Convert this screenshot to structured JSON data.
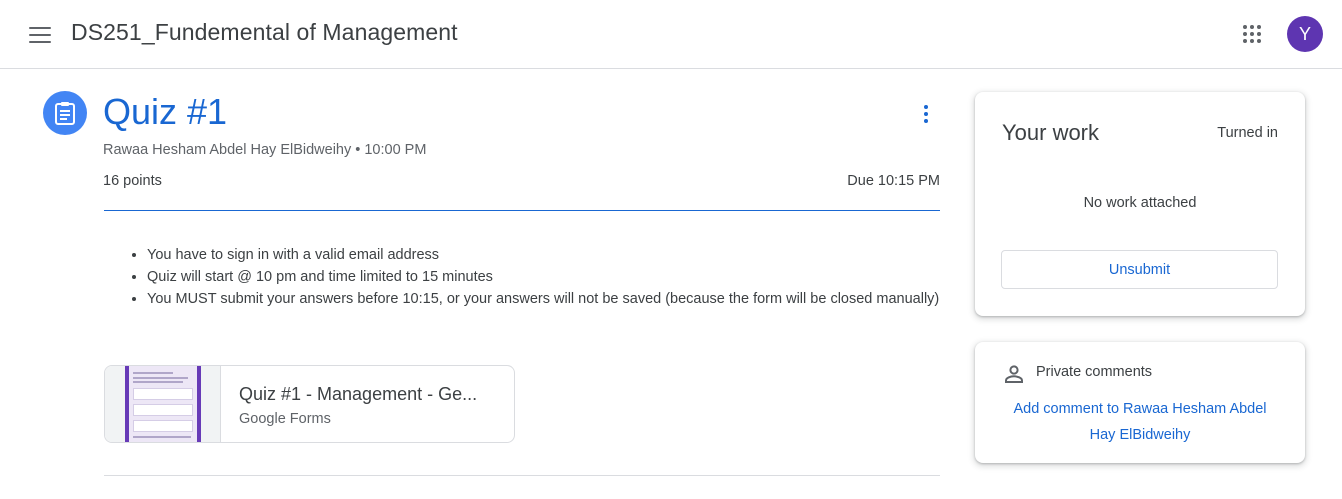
{
  "header": {
    "menu_icon": "hamburger-menu-icon",
    "class_title": "DS251_Fundemental of Management",
    "apps_icon": "google-apps-grid-icon",
    "avatar_letter": "Y",
    "avatar_color": "#5e35b1"
  },
  "assignment": {
    "icon": "assignment-clipboard-icon",
    "title": "Quiz #1",
    "meta": "Rawaa Hesham Abdel Hay ElBidweihy • 10:00 PM",
    "points": "16 points",
    "due": "Due 10:15 PM",
    "more_icon": "more-vert-icon",
    "instructions": [
      "You have to sign in with a valid email address",
      "Quiz will start @ 10 pm and time limited to 15 minutes",
      "You MUST submit your answers before 10:15, or your answers will not be saved (because the form will be closed manually)"
    ],
    "attachment": {
      "title": "Quiz #1 - Management - Ge...",
      "type": "Google Forms",
      "thumbnail": "google-forms-thumbnail"
    }
  },
  "your_work": {
    "title": "Your work",
    "status": "Turned in",
    "empty_text": "No work attached",
    "unsubmit_label": "Unsubmit"
  },
  "private_comments": {
    "icon": "person-outline-icon",
    "title": "Private comments",
    "add_label": "Add comment to Rawaa Hesham Abdel Hay ElBidweihy"
  },
  "colors": {
    "accent": "#1967d2",
    "assignment_icon_bg": "#4285f4",
    "forms_purple": "#673ab7"
  }
}
